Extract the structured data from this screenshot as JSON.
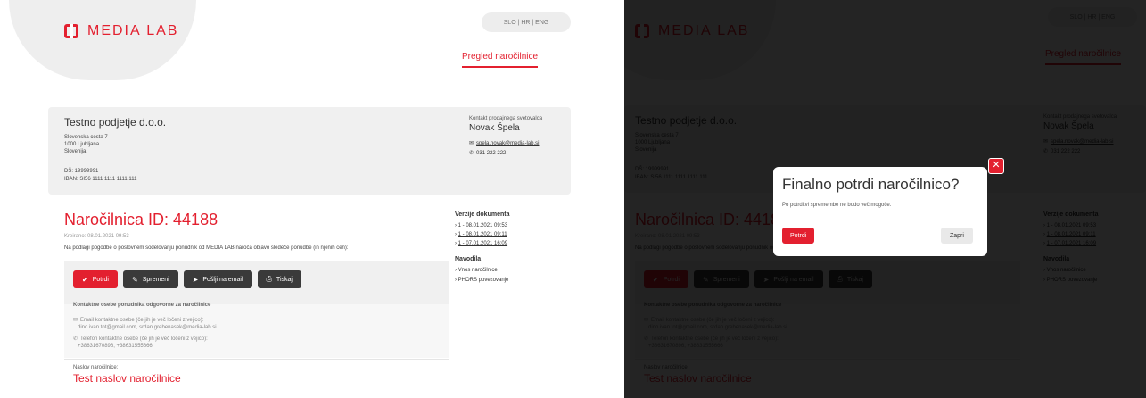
{
  "brand": {
    "name": "MEDIA LAB",
    "accent": "#e3202f"
  },
  "lang_switch": "SLO | HR | ENG",
  "nav": {
    "active_tab": "Pregled naročilnice"
  },
  "company": {
    "name": "Testno podjetje d.o.o.",
    "address": "Slovenska cesta 7\n1000 Ljubljana\nSlovenija",
    "tax": "DŠ: 19999991\nIBAN: SI56 1111 1111 1111 111",
    "contact_title": "Kontakt prodajnega svetovalca",
    "contact_name": "Novak Špela",
    "contact_email": "spela.novak@media-lab.si",
    "contact_phone": "031 222 222"
  },
  "order": {
    "title": "Naročilnica ID: 44188",
    "created": "Kreirano: 08.01.2021 09:53",
    "intro": "Na podlagi pogodbe o poslovnem sodelovanju ponudnik od MEDIA LAB naroča objavo sledeče ponudbe (in njenih cen):"
  },
  "versions": {
    "title": "Verzije dokumenta",
    "items": [
      "1 - 08.01.2021 09:53",
      "1 - 08.01.2021 09:11",
      "1 - 07.01.2021 16:09"
    ]
  },
  "instructions": {
    "title": "Navodila",
    "items": [
      "Vnos naročilnice",
      "PHORS povezovanje"
    ]
  },
  "toolbar": {
    "confirm": "Potrdi",
    "edit": "Spremeni",
    "send": "Pošlji na email",
    "print": "Tiskaj"
  },
  "contacts": {
    "title": "Kontaktne osebe ponudnika odgovorne za naročilnice",
    "email_label": "Email kontaktne osebe (če jih je več ločeni z vejico):",
    "email_value": "dino.ivan.tot@gmail.com, srdan.grebenasek@media-lab.si",
    "phone_label": "Telefon kontaktne osebe (če jih je več ločeni z vejico):",
    "phone_value": "+38631670896, +38631555666"
  },
  "heading": {
    "label": "Naslov naročilnice:",
    "value": "Test naslov naročilnice"
  },
  "modal": {
    "title": "Finalno potrdi naročilnico?",
    "description": "Po potrditvi spremembe ne bodo več mogoče.",
    "confirm": "Potrdi",
    "cancel": "Zapri"
  }
}
